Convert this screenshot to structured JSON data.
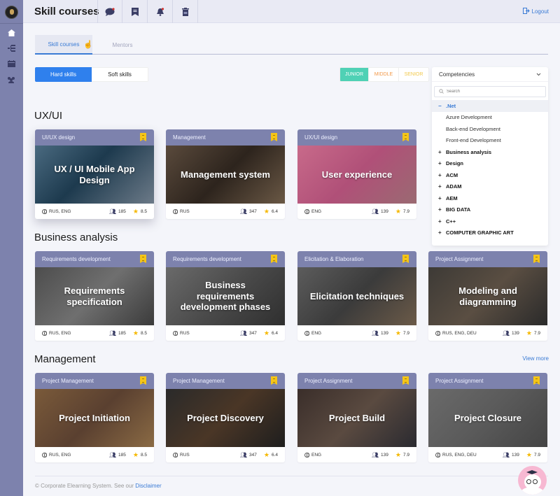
{
  "header": {
    "title": "Skill courses",
    "icons": [
      "chat-icon",
      "bookmark-icon",
      "bell-icon",
      "trash-icon"
    ],
    "logout_label": "Logout"
  },
  "sidebar": {
    "items": [
      "home-icon",
      "hierarchy-icon",
      "calendar-icon",
      "team-icon"
    ]
  },
  "tabs": [
    {
      "label": "Skill courses",
      "active": true
    },
    {
      "label": "Mentors",
      "active": false
    }
  ],
  "skill_types": [
    {
      "label": "Hard skills",
      "active": true
    },
    {
      "label": "Soft skills",
      "active": false
    }
  ],
  "levels": [
    {
      "label": "JUNIOR",
      "active": true,
      "color": "#4fd1b5"
    },
    {
      "label": "MIDDLE",
      "active": false,
      "color": "#f2994a"
    },
    {
      "label": "SENIOR",
      "active": false,
      "color": "#f2c94c"
    }
  ],
  "competencies": {
    "label": "Competencies",
    "search_placeholder": "Search",
    "items": [
      {
        "sign": "−",
        "label": ".Net",
        "kind": "open"
      },
      {
        "sign": "",
        "label": "Azure Development",
        "kind": "child"
      },
      {
        "sign": "",
        "label": "Back-end Development",
        "kind": "child"
      },
      {
        "sign": "",
        "label": "Front-end Development",
        "kind": "child"
      },
      {
        "sign": "+",
        "label": "Business analysis",
        "kind": "parent"
      },
      {
        "sign": "+",
        "label": "Design",
        "kind": "parent"
      },
      {
        "sign": "+",
        "label": "ACM",
        "kind": "parent"
      },
      {
        "sign": "+",
        "label": "ADAM",
        "kind": "parent"
      },
      {
        "sign": "+",
        "label": "AEM",
        "kind": "parent"
      },
      {
        "sign": "+",
        "label": "BIG DATA",
        "kind": "parent"
      },
      {
        "sign": "+",
        "label": "C++",
        "kind": "parent"
      },
      {
        "sign": "+",
        "label": "COMPUTER GRAPHIC ART",
        "kind": "parent"
      }
    ]
  },
  "sections": [
    {
      "title": "UX/UI",
      "view_more": "",
      "cards": [
        {
          "category": "UI/UX design",
          "title": "UX / UI Mobile App Design",
          "languages": "RUS, ENG",
          "students": "185",
          "rating": "8.5"
        },
        {
          "category": "Management",
          "title": "Management system",
          "languages": "RUS",
          "students": "347",
          "rating": "6.4"
        },
        {
          "category": "UX/UI design",
          "title": "User experience",
          "languages": "ENG",
          "students": "139",
          "rating": "7.9"
        }
      ]
    },
    {
      "title": "Business analysis",
      "view_more": "",
      "cards": [
        {
          "category": "Requirements development",
          "title": "Requirements specification",
          "languages": "RUS, ENG",
          "students": "185",
          "rating": "8.5"
        },
        {
          "category": "Requirements development",
          "title": "Business requirements development phases",
          "languages": "RUS",
          "students": "347",
          "rating": "6.4"
        },
        {
          "category": "Elicitation & Elaboration",
          "title": "Elicitation techniques",
          "languages": "ENG",
          "students": "139",
          "rating": "7.9"
        },
        {
          "category": "Project Assignment",
          "title": "Modeling and diagramming",
          "languages": "RUS, ENG, DEU",
          "students": "139",
          "rating": "7.9"
        }
      ]
    },
    {
      "title": "Management",
      "view_more": "View more",
      "cards": [
        {
          "category": "Project Management",
          "title": "Project Initiation",
          "languages": "RUS, ENG",
          "students": "185",
          "rating": "8.5"
        },
        {
          "category": "Project Management",
          "title": "Project Discovery",
          "languages": "RUS",
          "students": "347",
          "rating": "6.4"
        },
        {
          "category": "Project Assignment",
          "title": "Project Build",
          "languages": "ENG",
          "students": "139",
          "rating": "7.9"
        },
        {
          "category": "Project Assignment",
          "title": "Project Closure",
          "languages": "RUS, ENG, DEU",
          "students": "139",
          "rating": "7.9"
        }
      ]
    }
  ],
  "footer": {
    "text": "©  Corporate Elearning System.  See our ",
    "link": "Disclaimer"
  },
  "colors": {
    "accent": "#2f80ed",
    "sidebar": "#7d82ad",
    "bookmark": "#f5c518",
    "rating_star": "#f5b800"
  }
}
